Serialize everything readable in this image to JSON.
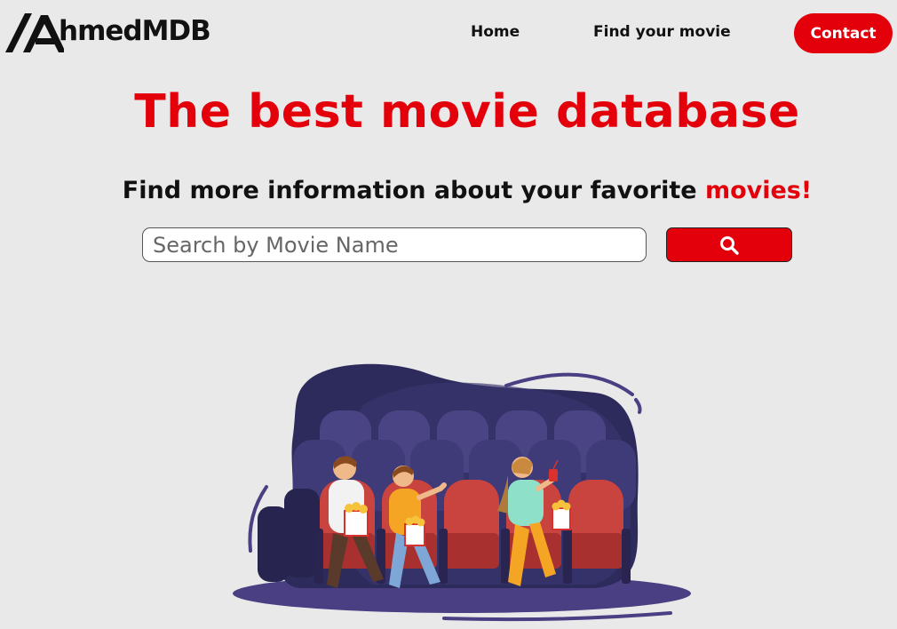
{
  "header": {
    "logo_text": "hmedMDB",
    "nav": {
      "home": "Home",
      "find": "Find your movie",
      "contact": "Contact"
    }
  },
  "hero": {
    "title": "The best movie database",
    "subtitle_main": "Find more information about your favorite ",
    "subtitle_accent": "movies!"
  },
  "search": {
    "placeholder": "Search by Movie Name",
    "icon": "search-icon"
  },
  "illustration": {
    "description_icon": "cinema-audience-illustration"
  },
  "colors": {
    "accent": "#e3000b",
    "background": "#e9e9e9",
    "illustration_dark": "#2d2a5c",
    "illustration_seat": "#c9433f"
  }
}
